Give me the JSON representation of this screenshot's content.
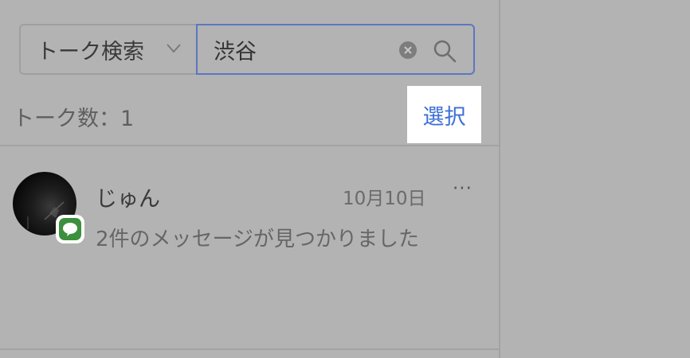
{
  "search": {
    "type_label": "トーク検索",
    "query": "渋谷"
  },
  "summary": {
    "count_text": "トーク数：1",
    "select_label": "選択"
  },
  "results": [
    {
      "name": "じゅん",
      "date": "10月10日",
      "snippet": "2件のメッセージが見つかりました",
      "badge_text": "LINE",
      "more_label": "···"
    }
  ],
  "colors": {
    "accent": "#3d6fd6",
    "line_green": "#3c8f3c"
  }
}
